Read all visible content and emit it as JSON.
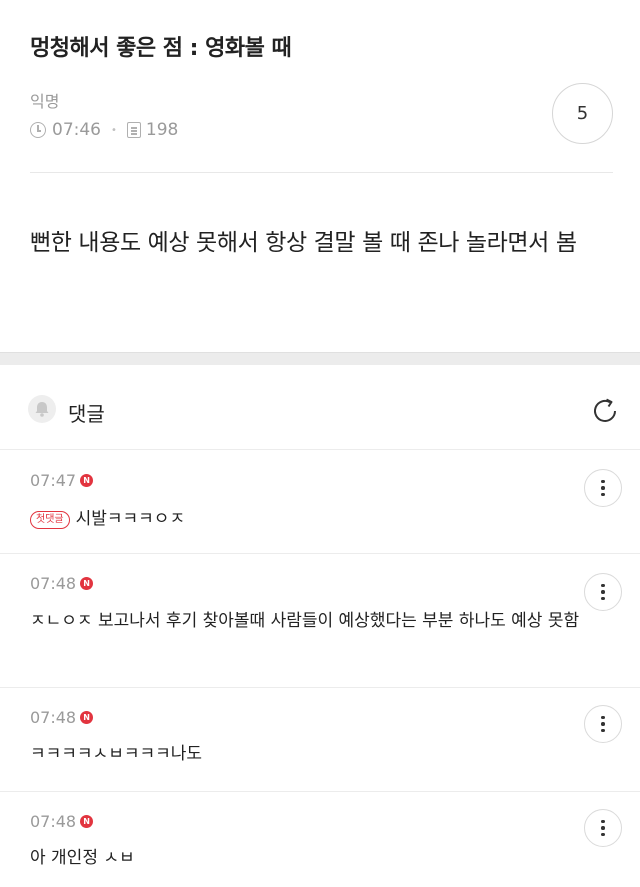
{
  "post": {
    "title": "멍청해서 좋은 점 : 영화볼 때",
    "author": "익명",
    "time": "07:46",
    "views": "198",
    "comment_count": "5",
    "body": "뻔한 내용도 예상 못해서 항상 결말 볼 때 존나 놀라면서 봄"
  },
  "comments_section": {
    "label": "댓글"
  },
  "comments": [
    {
      "time": "07:47",
      "badge": "N",
      "first_label": "첫댓글",
      "text": "시발ㅋㅋㅋㅇㅈ"
    },
    {
      "time": "07:48",
      "badge": "N",
      "text": "ㅈㄴㅇㅈ 보고나서 후기 찾아볼때 사람들이 예상했다는 부분 하나도 예상 못함"
    },
    {
      "time": "07:48",
      "badge": "N",
      "text": "ㅋㅋㅋㅋㅅㅂㅋㅋㅋ나도"
    },
    {
      "time": "07:48",
      "badge": "N",
      "text": "아 개인정 ㅅㅂ"
    }
  ],
  "colors": {
    "accent_red": "#e2343f",
    "muted_text": "#9a9a9a",
    "divider": "#ececec"
  }
}
